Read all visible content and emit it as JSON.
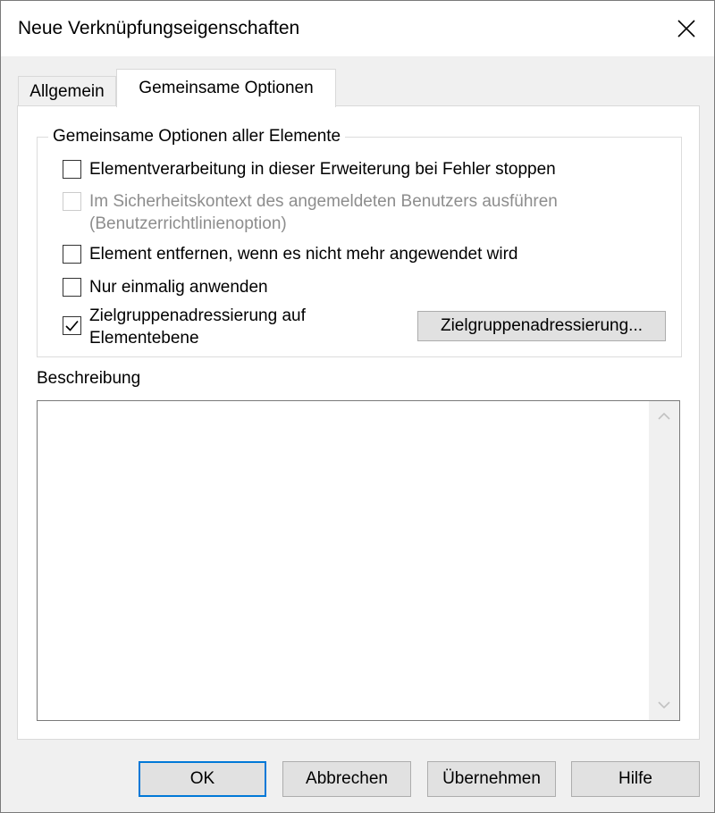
{
  "window": {
    "title": "Neue Verknüpfungseigenschaften"
  },
  "tabs": [
    {
      "label": "Allgemein",
      "active": false
    },
    {
      "label": "Gemeinsame Optionen",
      "active": true
    }
  ],
  "group": {
    "legend": "Gemeinsame Optionen aller Elemente",
    "options": [
      {
        "label": "Elementverarbeitung in dieser Erweiterung bei Fehler stoppen",
        "checked": false,
        "enabled": true
      },
      {
        "label_line1": "Im Sicherheitskontext des angemeldeten Benutzers ausführen",
        "label_line2": "(Benutzerrichtlinienoption)",
        "checked": false,
        "enabled": false
      },
      {
        "label": "Element entfernen, wenn es nicht mehr angewendet wird",
        "checked": false,
        "enabled": true
      },
      {
        "label": "Nur einmalig anwenden",
        "checked": false,
        "enabled": true
      },
      {
        "label_line1": "Zielgruppenadressierung auf",
        "label_line2": "Elementebene",
        "checked": true,
        "enabled": true
      }
    ],
    "targeting_button": "Zielgruppenadressierung..."
  },
  "description": {
    "label": "Beschreibung",
    "value": ""
  },
  "buttons": {
    "ok": "OK",
    "cancel": "Abbrechen",
    "apply": "Übernehmen",
    "help": "Hilfe"
  },
  "colors": {
    "focus_border": "#0078d7",
    "disabled_text": "#8d8d8d"
  },
  "icons": {
    "close": "close-icon",
    "check": "checkmark-icon",
    "scroll_up": "chevron-up-icon",
    "scroll_down": "chevron-down-icon"
  }
}
